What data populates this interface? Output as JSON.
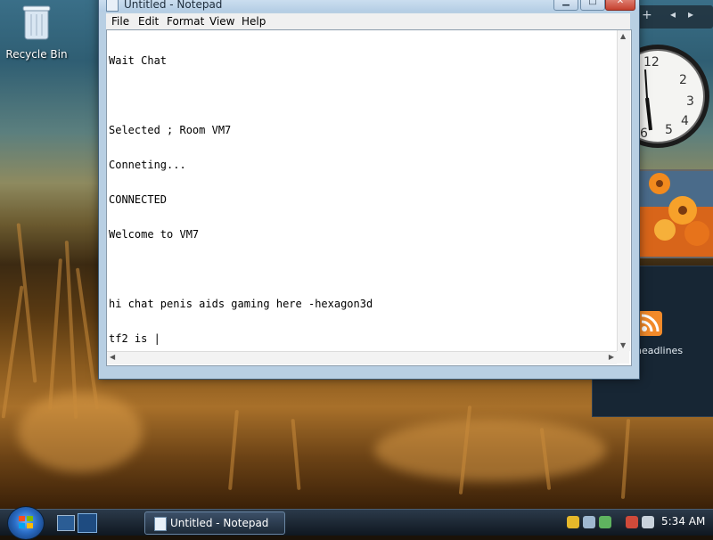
{
  "desktop": {
    "recycle_bin_label": "Recycle Bin"
  },
  "notepad": {
    "title": "Untitled - Notepad",
    "menu": [
      "File",
      "Edit",
      "Format",
      "View",
      "Help"
    ],
    "lines": [
      "Wait Chat",
      "",
      "Selected ; Room VM7",
      "Conneting...",
      "CONNECTED",
      "Welcome to VM7",
      "",
      "hi chat penis aids gaming here -hexagon3d",
      "tf2 is |"
    ]
  },
  "sidebar": {
    "feed_headline": "headlines"
  },
  "taskbar": {
    "task_label": "Untitled - Notepad",
    "clock": "5:34 AM"
  },
  "colors": {
    "taskbar": "#0f1720",
    "title_bar": "#b4cde4",
    "close": "#c5402e",
    "rss": "#f28a2a"
  },
  "icons": [
    "recycle-bin-icon",
    "notepad-icon",
    "windows-start-icon",
    "show-desktop-icon",
    "switch-windows-icon",
    "rss-icon",
    "clock-icon",
    "volume-icon",
    "network-icon",
    "security-icon"
  ]
}
